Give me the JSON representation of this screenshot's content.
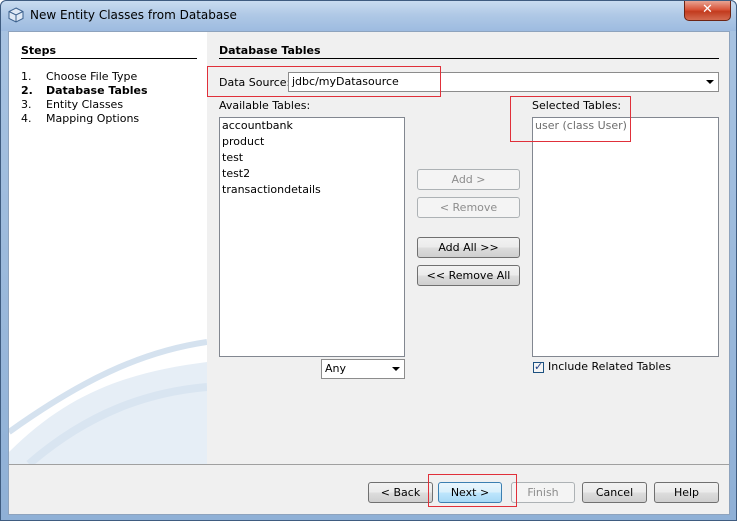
{
  "window": {
    "title": "New Entity Classes from Database",
    "close_label": "✕"
  },
  "steps": {
    "heading": "Steps",
    "items": [
      {
        "num": "1.",
        "label": "Choose File Type"
      },
      {
        "num": "2.",
        "label": "Database Tables"
      },
      {
        "num": "3.",
        "label": "Entity Classes"
      },
      {
        "num": "4.",
        "label": "Mapping Options"
      }
    ]
  },
  "main": {
    "heading": "Database Tables",
    "data_source_label": "Data Source:",
    "data_source_value": "jdbc/myDatasource",
    "available_label": "Available Tables:",
    "available_tables": [
      "accountbank",
      "product",
      "test",
      "test2",
      "transactiondetails"
    ],
    "selected_label": "Selected Tables:",
    "selected_tables": [
      "user (class User)"
    ],
    "filter_value": "Any",
    "add_label": "Add >",
    "remove_label": "< Remove",
    "add_all_label": "Add All >>",
    "remove_all_label": "<< Remove All",
    "include_related_label": "Include Related Tables",
    "include_related_checked": true
  },
  "footer": {
    "back_label": "< Back",
    "next_label": "Next >",
    "finish_label": "Finish",
    "cancel_label": "Cancel",
    "help_label": "Help"
  }
}
